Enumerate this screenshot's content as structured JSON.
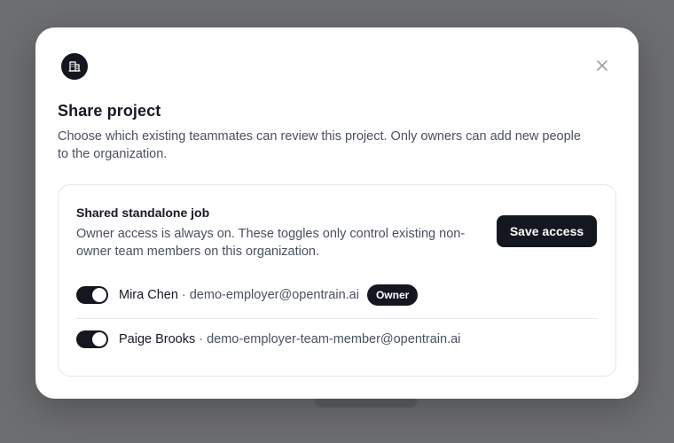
{
  "dialog": {
    "title": "Share project",
    "description": "Choose which existing teammates can review this project. Only owners can add new people to the organization.",
    "org_icon": "building-icon",
    "close_icon": "close-icon"
  },
  "card": {
    "title": "Shared standalone job",
    "description": "Owner access is always on. These toggles only control existing non-owner team members on this organization.",
    "save_label": "Save access"
  },
  "members": [
    {
      "name": "Mira Chen",
      "separator": "·",
      "email": "demo-employer@opentrain.ai",
      "badge": "Owner",
      "enabled": true
    },
    {
      "name": "Paige Brooks",
      "separator": "·",
      "email": "demo-employer-team-member@opentrain.ai",
      "enabled": true
    }
  ],
  "colors": {
    "accent": "#14171f",
    "backdrop": "#6d6e70",
    "text_muted": "#4a5060"
  }
}
